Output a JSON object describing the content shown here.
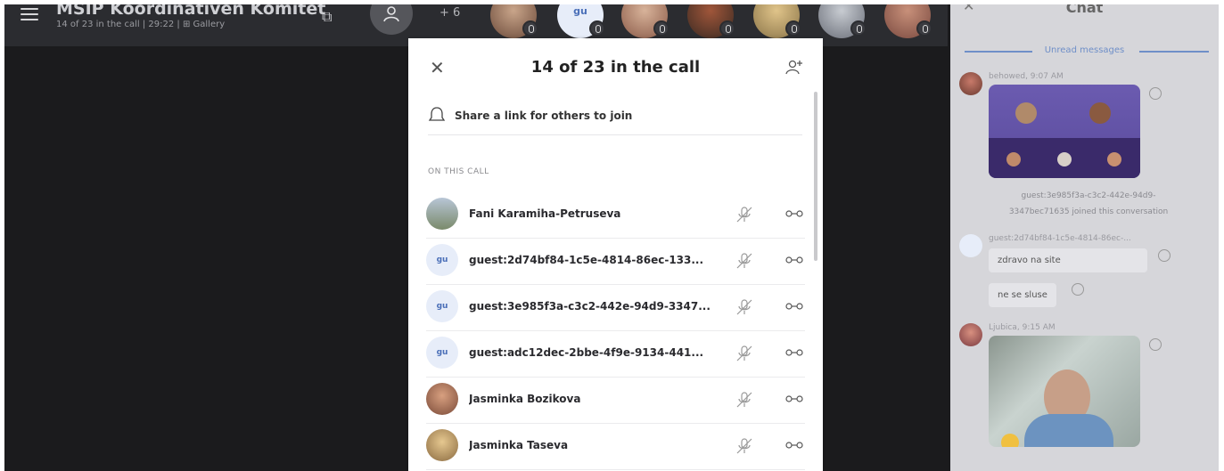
{
  "meeting": {
    "title": "MSIP Koordinativen Komitet",
    "subtitle": "14 of 23 in the call | 29:22 | ⊞ Gallery",
    "extra_count": "+ 6",
    "guest_initials": "gu"
  },
  "participants_panel": {
    "title": "14 of 23 in the call",
    "share_label": "Share a link for others to join",
    "section_label": "ON THIS CALL",
    "participants": [
      {
        "name": "Fani Karamiha-Petruseva",
        "avatar": "photo"
      },
      {
        "name": "guest:2d74bf84-1c5e-4814-86ec-133...",
        "avatar": "gu"
      },
      {
        "name": "guest:3e985f3a-c3c2-442e-94d9-3347...",
        "avatar": "gu"
      },
      {
        "name": "guest:adc12dec-2bbe-4f9e-9134-441...",
        "avatar": "gu"
      },
      {
        "name": "Jasminka Bozikova",
        "avatar": "photo"
      },
      {
        "name": "Jasminka Taseva",
        "avatar": "photo"
      }
    ]
  },
  "chat": {
    "title": "Chat",
    "unread_label": "Unread messages",
    "msg1_meta": "behowed, 9:07 AM",
    "system_line1": "guest:3e985f3a-c3c2-442e-94d9-",
    "system_line2": "3347bec71635 joined this conversation",
    "msg2_meta": "guest:2d74bf84-1c5e-4814-86ec-...",
    "msg2_bubble1": "zdravo na site",
    "msg2_bubble2": "ne se sluse",
    "msg3_meta": "Ljubica, 9:15 AM"
  },
  "colors": {
    "accent": "#6f8fc8",
    "topbar": "#2b2c30",
    "stage": "#1b1b1d",
    "chat_bg": "#d6d6da"
  },
  "icons": [
    "menu-icon",
    "pip-icon",
    "people-icon",
    "close-icon",
    "add-person-icon",
    "link-icon",
    "mic-off-icon",
    "more-icon",
    "reaction-icon"
  ]
}
